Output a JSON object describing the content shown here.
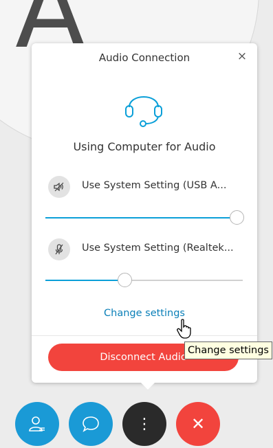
{
  "background": {
    "avatar_letter": "A"
  },
  "dialog": {
    "title": "Audio Connection",
    "close_symbol": "×",
    "mode_text": "Using Computer for Audio",
    "speaker": {
      "label": "Use System Setting (USB A...",
      "volume_percent": 97
    },
    "microphone": {
      "label": "Use System Setting (Realtek...",
      "volume_percent": 40
    },
    "change_settings_link": "Change settings",
    "disconnect_button": "Disconnect Audio"
  },
  "tooltip": {
    "text": "Change settings"
  },
  "toolbar": {
    "more_symbol": "⋮",
    "end_symbol": "✕",
    "colors": {
      "participants": "#1a9ad6",
      "chat": "#1a9ad6",
      "more": "#2a2a2a",
      "end": "#f2443d"
    }
  },
  "colors": {
    "accent": "#0a9fd8",
    "link": "#0a7fb8",
    "danger": "#f2443d"
  }
}
